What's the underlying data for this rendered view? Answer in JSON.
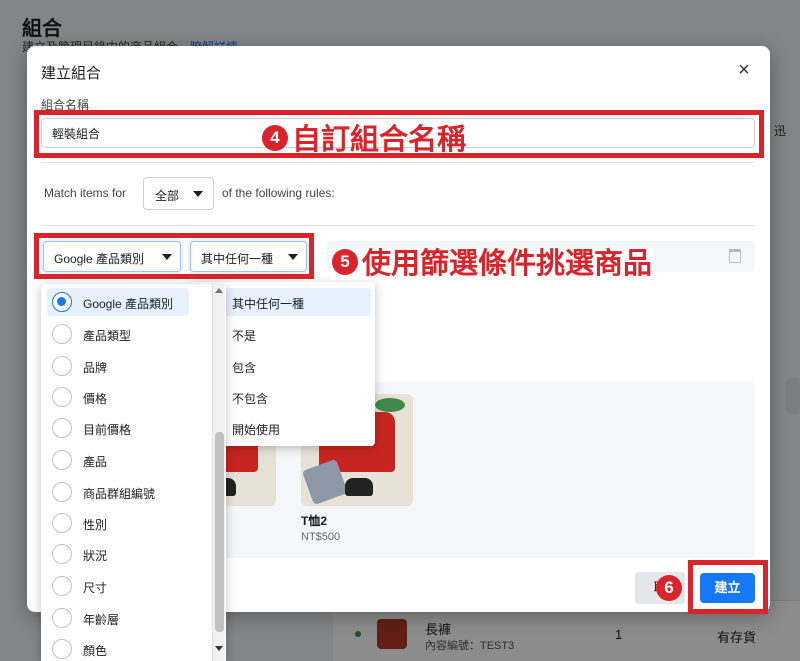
{
  "background": {
    "title": "組合",
    "subtitle": "建立及管理目錄中的商品組合。",
    "subtitle_link": "瞭解詳情",
    "right_text": "，迅",
    "row": {
      "name": "長褲",
      "code": "內容編號：TEST3",
      "qty": "1",
      "stock": "有存貨"
    }
  },
  "modal": {
    "title": "建立組合",
    "close_label": "×",
    "name_label": "組合名稱",
    "name_value": "輕裝組合",
    "match_prefix": "Match items for",
    "match_value": "全部",
    "match_suffix": "of the following rules:",
    "filter_field": "Google 產品類別",
    "filter_operator": "其中任何一種",
    "cancel_label": "取",
    "create_label": "建立"
  },
  "field_dropdown": {
    "options": [
      "Google 產品類別",
      "產品類型",
      "品牌",
      "價格",
      "目前價格",
      "產品",
      "商品群組編號",
      "性別",
      "狀況",
      "尺寸",
      "年齡層",
      "顏色"
    ],
    "selected": "Google 產品類別"
  },
  "operator_dropdown": {
    "options": [
      "其中任何一種",
      "不是",
      "包含",
      "不包含",
      "開始使用"
    ],
    "selected": "其中任何一種"
  },
  "products": [
    {
      "name": "",
      "price": ""
    },
    {
      "name": "T恤2",
      "price": "NT$500"
    }
  ],
  "annotations": {
    "step4_num": "4",
    "step4_text": "自訂組合名稱",
    "step5_num": "5",
    "step5_text": "使用篩選條件挑選商品",
    "step6_num": "6"
  },
  "colors": {
    "accent": "#1877f2",
    "annotation": "#d9242b"
  }
}
